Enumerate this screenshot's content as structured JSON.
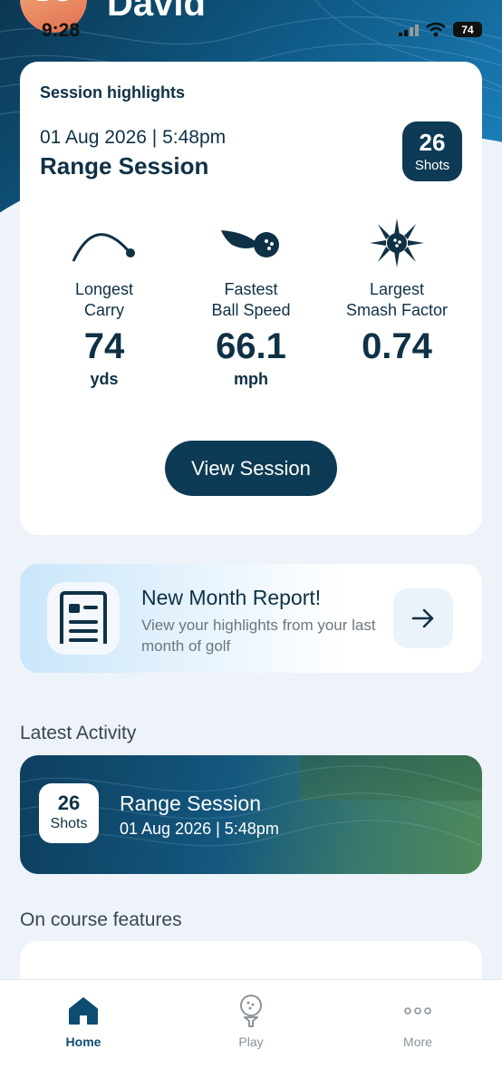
{
  "status_bar": {
    "time": "9:28",
    "battery": "74"
  },
  "header": {
    "avatar_initials": "DS",
    "user_name": "David"
  },
  "highlights": {
    "label": "Session highlights",
    "date": "01 Aug 2026 | 5:48pm",
    "title": "Range Session",
    "shots_count": "26",
    "shots_label": "Shots",
    "metrics": [
      {
        "name_line1": "Longest",
        "name_line2": "Carry",
        "value": "74",
        "unit": "yds",
        "icon": "trajectory-icon"
      },
      {
        "name_line1": "Fastest",
        "name_line2": "Ball Speed",
        "value": "66.1",
        "unit": "mph",
        "icon": "speeding-ball-icon"
      },
      {
        "name_line1": "Largest",
        "name_line2": "Smash Factor",
        "value": "0.74",
        "unit": "",
        "icon": "impact-burst-icon"
      }
    ],
    "button_label": "View Session"
  },
  "report": {
    "title": "New Month Report!",
    "description": "View your highlights from your last month of golf",
    "icon": "document-icon",
    "action_icon": "arrow-right-icon"
  },
  "latest_activity": {
    "heading": "Latest Activity",
    "shots_count": "26",
    "shots_label": "Shots",
    "title": "Range Session",
    "date": "01 Aug 2026 | 5:48pm"
  },
  "features": {
    "heading": "On course features"
  },
  "tabbar": {
    "tabs": [
      {
        "label": "Home",
        "icon": "home-icon",
        "active": true
      },
      {
        "label": "Play",
        "icon": "golf-ball-tee-icon",
        "active": false
      },
      {
        "label": "More",
        "icon": "more-dots-icon",
        "active": false
      }
    ]
  },
  "colors": {
    "primary": "#0d3a54",
    "background": "#eef3fa",
    "accent": "#0f4c71"
  }
}
